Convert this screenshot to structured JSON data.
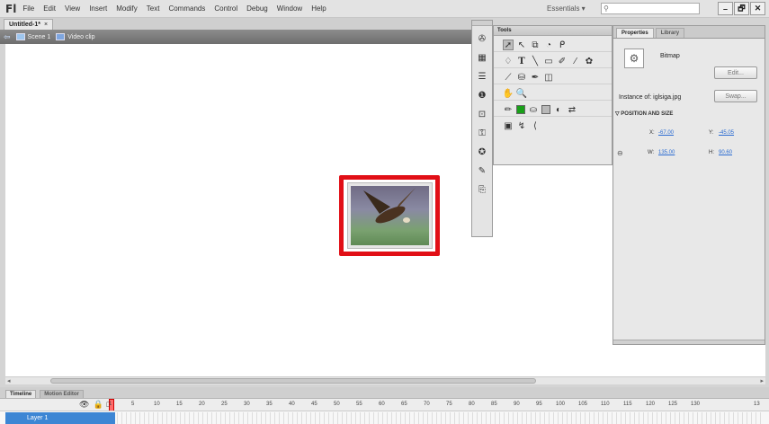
{
  "app": {
    "logo": "Fl"
  },
  "menu": [
    "File",
    "Edit",
    "View",
    "Insert",
    "Modify",
    "Text",
    "Commands",
    "Control",
    "Debug",
    "Window",
    "Help"
  ],
  "workspace": {
    "label": "Essentials ▾"
  },
  "window_controls": {
    "minimize": "–",
    "maximize": "🗗",
    "close": "✕"
  },
  "document_tab": {
    "title": "Untitled-1*",
    "close": "×"
  },
  "breadcrumb": {
    "scene": "Scene 1",
    "symbol": "Video clip"
  },
  "timeline": {
    "tabs": [
      "Timeline",
      "Motion Editor"
    ],
    "frame_numbers": [
      "1",
      "5",
      "10",
      "15",
      "20",
      "25",
      "30",
      "35",
      "40",
      "45",
      "50",
      "55",
      "60",
      "65",
      "70",
      "75",
      "80",
      "85",
      "90",
      "95",
      "100",
      "105",
      "110",
      "115",
      "120",
      "125",
      "130",
      "13"
    ],
    "layer": "Layer 1"
  },
  "tools_panel": {
    "title": "Tools"
  },
  "properties_panel": {
    "tabs": [
      "Properties",
      "Library"
    ],
    "type_label": "Bitmap",
    "edit_button": "Edit...",
    "instance_of_label": "Instance of: iglsiga.jpg",
    "swap_button": "Swap...",
    "section_title": "POSITION AND SIZE",
    "x_label": "X:",
    "x_value": "-67.00",
    "y_label": "Y:",
    "y_value": "-45.05",
    "w_label": "W:",
    "w_value": "135.00",
    "h_label": "H:",
    "h_value": "90.60"
  },
  "colors": {
    "highlight": "#e10f16",
    "accent": "#3d86d4",
    "fill_swatch": "#19a019"
  }
}
